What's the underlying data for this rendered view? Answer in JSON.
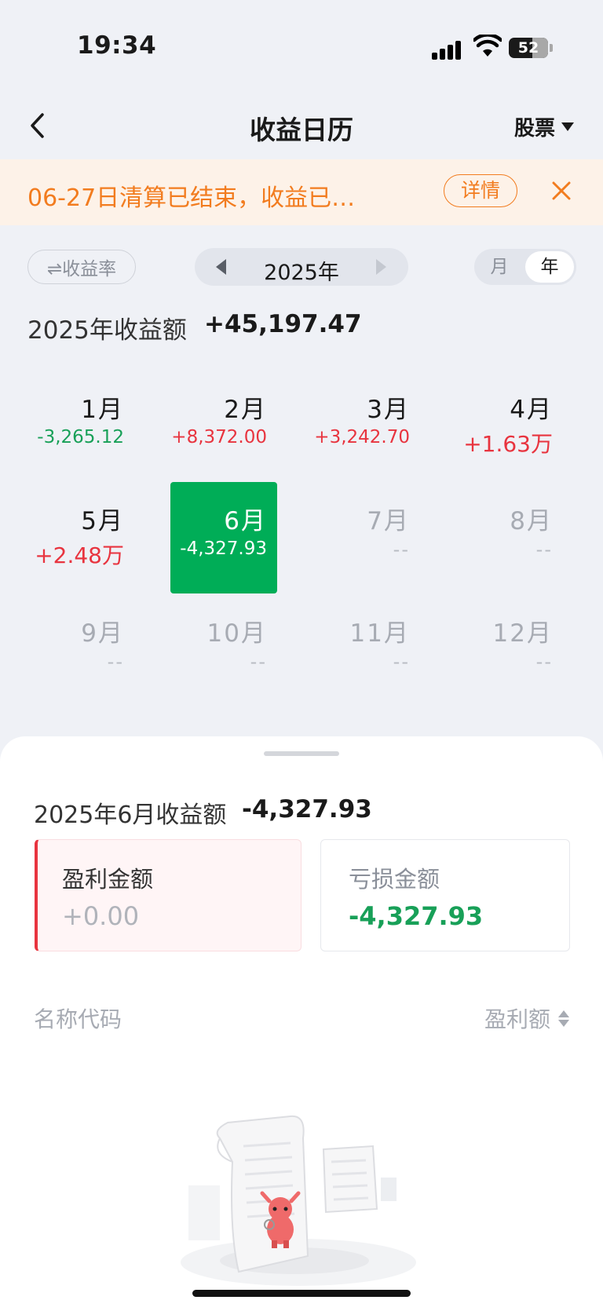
{
  "status_bar": {
    "time": "19:34",
    "battery": "52"
  },
  "nav": {
    "title": "收益日历",
    "filter_label": "股票"
  },
  "notice": {
    "text": "06-27日清算已结束，收益已…",
    "detail_label": "详情"
  },
  "controls": {
    "rate_toggle_label": "⇌收益率",
    "year_label": "2025年",
    "segment_month": "月",
    "segment_year": "年"
  },
  "summary": {
    "label": "2025年收益额",
    "value": "+45,197.47"
  },
  "months": [
    {
      "label": "1月",
      "value": "-3,265.12",
      "tone": "green"
    },
    {
      "label": "2月",
      "value": "+8,372.00",
      "tone": "red"
    },
    {
      "label": "3月",
      "value": "+3,242.70",
      "tone": "red"
    },
    {
      "label": "4月",
      "value": "+1.63万",
      "tone": "red-big"
    },
    {
      "label": "5月",
      "value": "+2.48万",
      "tone": "red-big"
    },
    {
      "label": "6月",
      "value": "-4,327.93",
      "tone": "selected"
    },
    {
      "label": "7月",
      "value": "--",
      "tone": "future"
    },
    {
      "label": "8月",
      "value": "--",
      "tone": "future"
    },
    {
      "label": "9月",
      "value": "--",
      "tone": "future"
    },
    {
      "label": "10月",
      "value": "--",
      "tone": "future"
    },
    {
      "label": "11月",
      "value": "--",
      "tone": "future"
    },
    {
      "label": "12月",
      "value": "--",
      "tone": "future"
    }
  ],
  "sheet": {
    "month_total_label": "2025年6月收益额",
    "month_total_value": "-4,327.93",
    "profit": {
      "title": "盈利金额",
      "value": "+0.00"
    },
    "loss": {
      "title": "亏损金额",
      "value": "-4,327.93"
    },
    "list": {
      "name_col": "名称代码",
      "sort_col": "盈利额"
    }
  },
  "colors": {
    "profit_red": "#e8343f",
    "loss_green": "#18a058",
    "notice_orange": "#f27c1f",
    "selected_green": "#00ad57"
  }
}
